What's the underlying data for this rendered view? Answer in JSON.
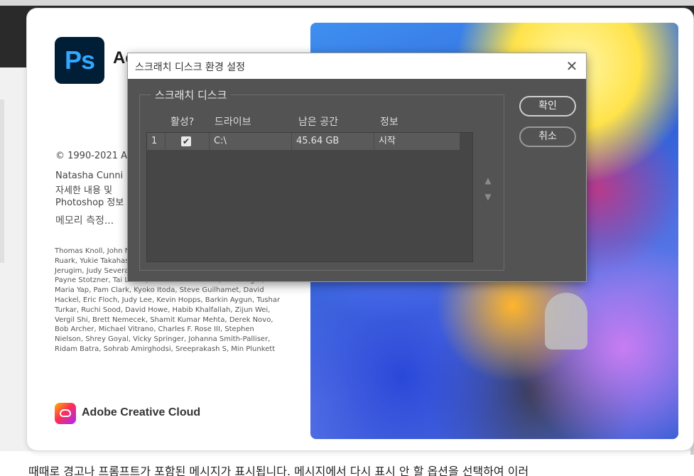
{
  "background": {
    "bottom_text": "때때로 경고나 프롬프트가 포함된 메시지가 표시됩니다. 메시지에서 다시 표시 안 할 옵션을 선택하여 이러"
  },
  "splash": {
    "logo_text": "Ps",
    "product_title": "Ac",
    "copyright": "© 1990-2021 A",
    "lines": [
      "Natasha  Cunni",
      "자세한 내용 및",
      "Photoshop 정보"
    ],
    "memory_label": "메모리 측정...",
    "credits": "Thomas Knoll, John Narayanan, Russell Erickson, Sarah Kor Ruark, Yukie Takahashi, David Dobish, John Peterson, Adam Jerugim, Judy Severance, Yuko Kagita, Foster Brereton, Meredith Payne Stotzner, Tai Luxon, Vinod Balakrishnan, Tim Wright, Maria Yap, Pam Clark, Kyoko Itoda, Steve Guilhamet, David Hackel, Eric Floch, Judy Lee, Kevin Hopps, Barkin Aygun, Tushar Turkar, Ruchi Sood, David Howe, Habib Khalfallah, Zijun Wei, Vergil Shi, Brett Nemecek, Shamit Kumar Mehta, Derek Novo, Bob Archer, Michael Vitrano, Charles F. Rose III, Stephen Nielson, Shrey Goyal, Vicky Springer, Johanna Smith-Palliser, Ridam Batra, Sohrab Amirghodsi, Sreeprakash S, Min Plunkett",
    "cc_label": "Adobe Creative Cloud"
  },
  "dialog": {
    "title": "스크래치 디스크 환경 설정",
    "group_label": "스크래치 디스크",
    "columns": {
      "active": "활성?",
      "drive": "드라이브",
      "free_space": "남은 공간",
      "info": "정보"
    },
    "rows": [
      {
        "index": "1",
        "active": true,
        "drive": "C:\\",
        "free_space": "45.64 GB",
        "info": "시작"
      }
    ],
    "ok_label": "확인",
    "cancel_label": "취소",
    "checkmark": "✔",
    "up_arrow": "▲",
    "down_arrow": "▼",
    "close_glyph": "✕"
  },
  "colors": {
    "ps_logo_bg": "#001e36",
    "ps_logo_fg": "#31a8ff",
    "dialog_bg": "#535353"
  }
}
